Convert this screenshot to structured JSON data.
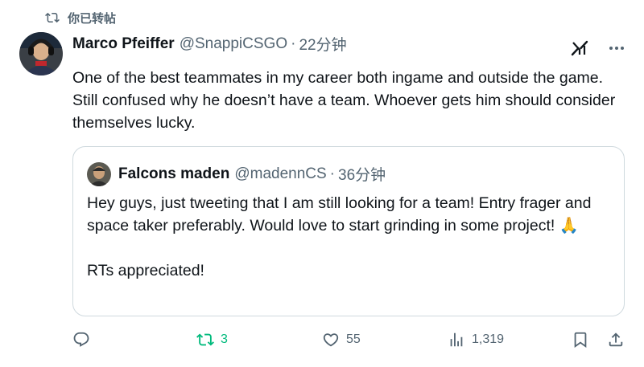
{
  "repost_bar": {
    "icon": "repost-icon",
    "label": "你已转帖"
  },
  "tweet": {
    "author_name": "Marco Pfeiffer",
    "author_handle": "@SnappiCSGO",
    "separator": "·",
    "time": "22分钟",
    "text": "One of the best teammates in my career both ingame and outside the game. Still confused why he doesn’t have a team. Whoever gets him should consider themselves lucky."
  },
  "quote": {
    "author_name": "Falcons maden",
    "author_handle": "@madennCS",
    "separator": "·",
    "time": "36分钟",
    "line1": "Hey guys, just tweeting that I am still looking for a team! Entry frager and space taker preferably. Would love to start grinding in some project! 🙏",
    "line2": "RTs appreciated!"
  },
  "actions": {
    "reply": {
      "icon": "reply-icon",
      "count": ""
    },
    "retweet": {
      "icon": "retweet-icon",
      "count": "3",
      "color": "#00ba7c"
    },
    "like": {
      "icon": "heart-icon",
      "count": "55"
    },
    "views": {
      "icon": "views-icon",
      "count": "1,319"
    },
    "bookmark": {
      "icon": "bookmark-icon"
    },
    "share": {
      "icon": "share-icon"
    }
  },
  "colors": {
    "text": "#0f1419",
    "secondary": "#536471",
    "border": "#cfd9de",
    "retweet_green": "#00ba7c"
  }
}
